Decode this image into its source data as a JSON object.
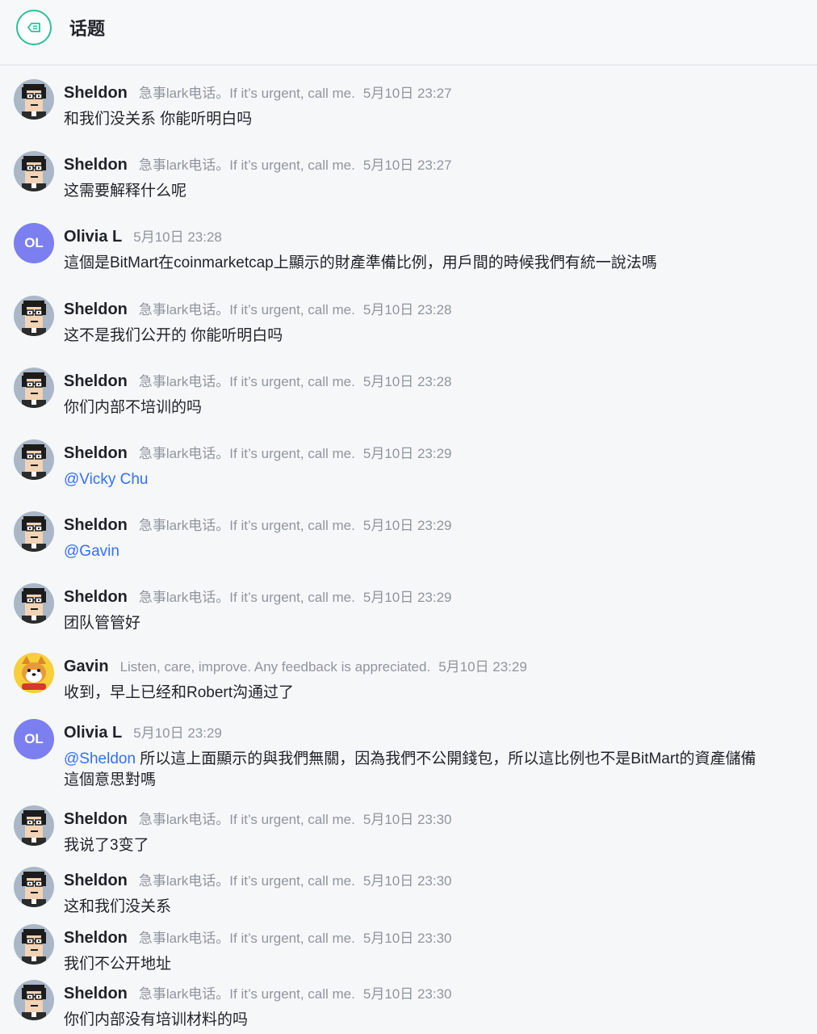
{
  "header": {
    "title": "话题",
    "back_icon": "topic-back-icon"
  },
  "colors": {
    "accent": "#2cbf9b",
    "mention": "#3370ff",
    "initials_avatar": "#7b7ff0"
  },
  "messages": [
    {
      "sender": "Sheldon",
      "signature": "急事lark电话。If it’s urgent, call me.",
      "time": "5月10日 23:27",
      "text": "和我们没关系 你能听明白吗",
      "avatar": "pixel-avatar"
    },
    {
      "sender": "Sheldon",
      "signature": "急事lark电话。If it’s urgent, call me.",
      "time": "5月10日 23:27",
      "text": "这需要解释什么呢",
      "avatar": "pixel-avatar"
    },
    {
      "sender": "Olivia L",
      "signature": "",
      "time": "5月10日 23:28",
      "text": "這個是BitMart在coinmarketcap上顯示的財產準備比例，用戶間的時候我們有統一說法嗎",
      "avatar": "initials",
      "initials": "OL"
    },
    {
      "sender": "Sheldon",
      "signature": "急事lark电话。If it’s urgent, call me.",
      "time": "5月10日 23:28",
      "text": "这不是我们公开的 你能听明白吗",
      "avatar": "pixel-avatar"
    },
    {
      "sender": "Sheldon",
      "signature": "急事lark电话。If it’s urgent, call me.",
      "time": "5月10日 23:28",
      "text": "你们内部不培训的吗",
      "avatar": "pixel-avatar"
    },
    {
      "sender": "Sheldon",
      "signature": "急事lark电话。If it’s urgent, call me.",
      "time": "5月10日 23:29",
      "mention": "@Vicky Chu",
      "text": "",
      "avatar": "pixel-avatar"
    },
    {
      "sender": "Sheldon",
      "signature": "急事lark电话。If it’s urgent, call me.",
      "time": "5月10日 23:29",
      "mention": "@Gavin",
      "text": "",
      "avatar": "pixel-avatar"
    },
    {
      "sender": "Sheldon",
      "signature": "急事lark电话。If it’s urgent, call me.",
      "time": "5月10日 23:29",
      "text": "团队管管好",
      "avatar": "pixel-avatar"
    },
    {
      "sender": "Gavin",
      "signature": "Listen, care, improve. Any feedback is appreciated.",
      "time": "5月10日 23:29",
      "text": "收到，早上已经和Robert沟通过了",
      "avatar": "dog-avatar"
    },
    {
      "sender": "Olivia L",
      "signature": "",
      "time": "5月10日 23:29",
      "mention": "@Sheldon",
      "text": " 所以這上面顯示的與我們無關，因為我們不公開錢包，所以這比例也不是BitMart的資產儲備\n這個意思對嗎",
      "avatar": "initials",
      "initials": "OL"
    },
    {
      "sender": "Sheldon",
      "signature": "急事lark电话。If it’s urgent, call me.",
      "time": "5月10日 23:30",
      "text": "我说了3变了",
      "avatar": "pixel-avatar"
    },
    {
      "sender": "Sheldon",
      "signature": "急事lark电话。If it’s urgent, call me.",
      "time": "5月10日 23:30",
      "text": "这和我们没关系",
      "avatar": "pixel-avatar"
    },
    {
      "sender": "Sheldon",
      "signature": "急事lark电话。If it’s urgent, call me.",
      "time": "5月10日 23:30",
      "text": "我们不公开地址",
      "avatar": "pixel-avatar"
    },
    {
      "sender": "Sheldon",
      "signature": "急事lark电话。If it’s urgent, call me.",
      "time": "5月10日 23:30",
      "text": "你们内部没有培训材料的吗",
      "avatar": "pixel-avatar"
    }
  ]
}
